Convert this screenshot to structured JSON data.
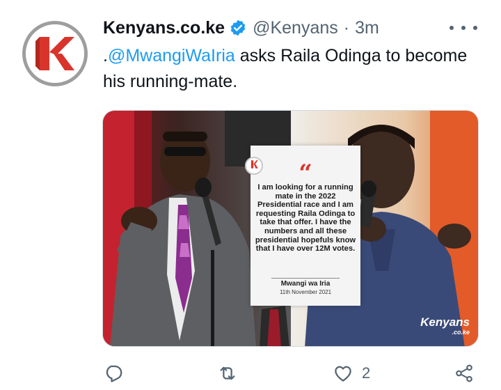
{
  "tweet": {
    "author_name": "Kenyans.co.ke",
    "handle": "@Kenyans",
    "separator": "·",
    "time": "3m",
    "text_prefix": ".",
    "mention": "@MwangiWaIria",
    "text_rest": " asks Raila Odinga to become his running-mate."
  },
  "media": {
    "quote": "I am looking for a running mate in the 2022 Presidential race and I am requesting Raila Odinga to take that offer. I have the numbers and all these presidential hopefuls know that I have over 12M votes.",
    "quote_author": "Mwangi wa Iria",
    "quote_date": "11th November 2021",
    "watermark": "Kenyans",
    "watermark_sub": ".co.ke"
  },
  "actions": {
    "reply_count": "",
    "retweet_count": "",
    "like_count": "2",
    "share_count": ""
  },
  "icons": {
    "verified": "verified-badge-icon",
    "more": "more-options-icon",
    "reply": "reply-icon",
    "retweet": "retweet-icon",
    "like": "heart-icon",
    "share": "share-icon"
  },
  "colors": {
    "accent": "#1d9bf0",
    "secondary_text": "#536471",
    "brand_red": "#d9342b"
  }
}
